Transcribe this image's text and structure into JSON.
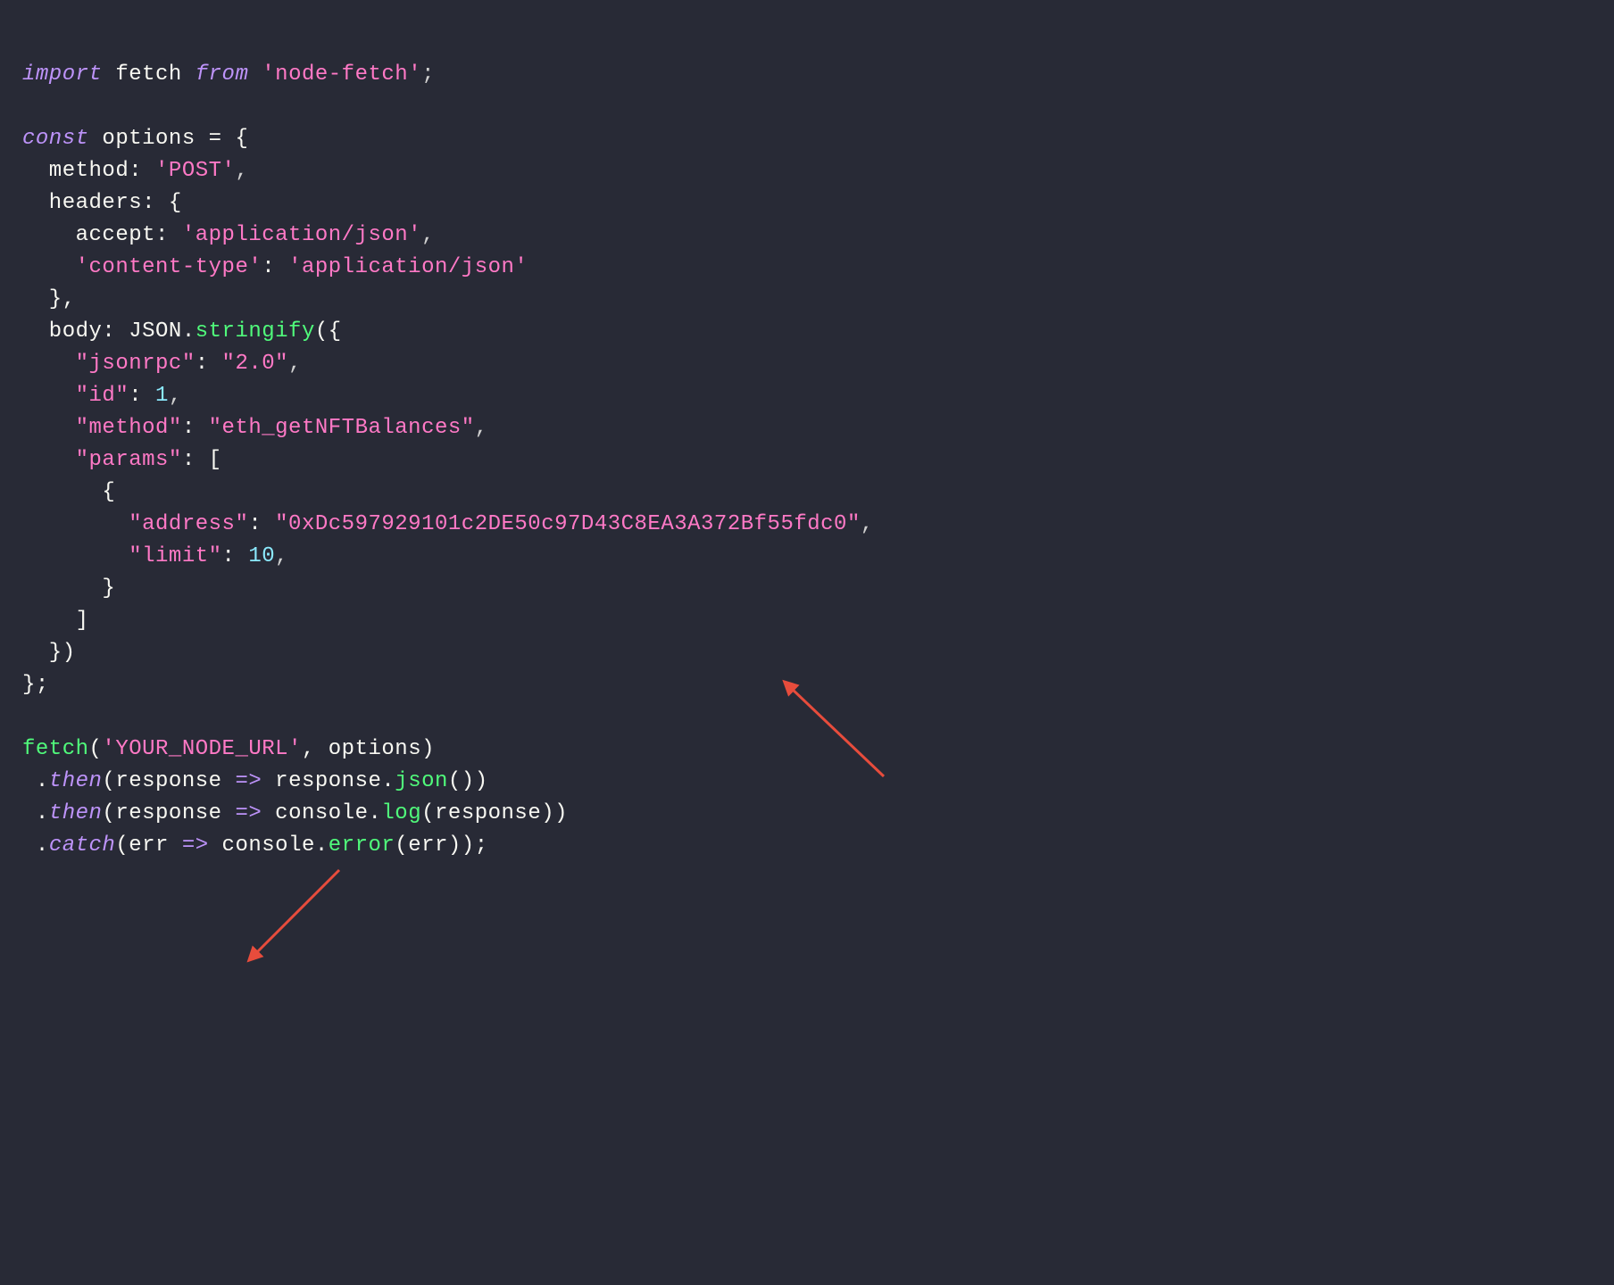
{
  "code": {
    "import": "import",
    "fetchKeyword": " fetch ",
    "from": "from",
    "nodeFetch": " 'node-fetch'",
    "semicolon": ";",
    "const": "const",
    "optionsDecl": " options = {",
    "methodKey": "  method: ",
    "methodVal": "'POST'",
    "comma": ",",
    "headersKey": "  headers: {",
    "acceptKey": "    accept: ",
    "acceptVal": "'application/json'",
    "contentTypeKey": "    'content-type'",
    "contentTypeColon": ": ",
    "contentTypeVal": "'application/json'",
    "closeBrace1": "  },",
    "bodyKey": "  body: JSON.",
    "stringifyMethod": "stringify",
    "stringifyOpen": "({",
    "jsonrpcKey": "    \"jsonrpc\"",
    "jsonrpcColon": ": ",
    "jsonrpcVal": "\"2.0\"",
    "idKey": "    \"id\"",
    "idColon": ": ",
    "idVal": "1",
    "methodKey2": "    \"method\"",
    "methodColon2": ": ",
    "methodVal2": "\"eth_getNFTBalances\"",
    "paramsKey": "    \"params\"",
    "paramsColon": ": [",
    "paramsBraceOpen": "      {",
    "addressKey": "        \"address\"",
    "addressColon": ": ",
    "addressVal": "\"0xDc597929101c2DE50c97D43C8EA3A372Bf55fdc0\"",
    "limitKey": "        \"limit\"",
    "limitColon": ": ",
    "limitVal": "10",
    "paramsBraceClose": "      }",
    "paramsBracketClose": "    ]",
    "stringifyClose": "  })",
    "optionsClose": "};",
    "fetchCall": "fetch",
    "fetchOpen": "(",
    "fetchUrl": "'YOUR_NODE_URL'",
    "fetchOptions": ", options)",
    "thenLine1a": " .",
    "then": "then",
    "thenLine1b": "(response ",
    "arrow": "=>",
    "thenLine1c": " response.",
    "json": "json",
    "thenLine1d": "())",
    "thenLine2a": " .",
    "thenLine2b": "(response ",
    "thenLine2c": " console.",
    "log": "log",
    "thenLine2d": "(response))",
    "catchLine1a": " .",
    "catch": "catch",
    "catchLine1b": "(err ",
    "catchLine1c": " console.",
    "error": "error",
    "catchLine1d": "(err));"
  },
  "colors": {
    "background": "#282a36",
    "text": "#f8f8f2",
    "keyword": "#bd93f9",
    "string": "#ff79c6",
    "method": "#50fa7b",
    "number": "#8be9fd",
    "arrow": "#e74c3c"
  }
}
